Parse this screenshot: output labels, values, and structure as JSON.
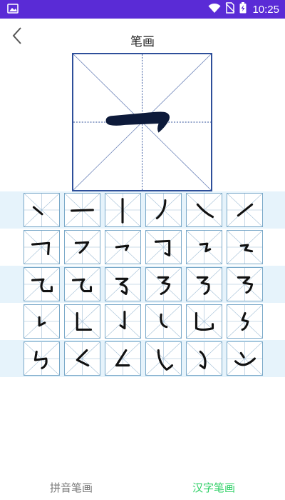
{
  "status_bar": {
    "time": "10:25",
    "bg_color": "#5a2bd6"
  },
  "header": {
    "title": "笔画",
    "back_icon": "chevron-left-icon"
  },
  "practice": {
    "character": "一",
    "border_color": "#2e4f9a"
  },
  "strokes": {
    "rows": 5,
    "columns": 6,
    "items": [
      "dian-stroke-icon",
      "heng-stroke-icon",
      "shu-stroke-icon",
      "pie-stroke-icon",
      "na-stroke-icon",
      "ti-stroke-icon",
      "hengzhe-stroke-icon",
      "henggou-stroke-icon",
      "hengpie-stroke-icon",
      "hengzhegou-stroke-icon",
      "hengzheti-stroke-icon",
      "hengzhewan-stroke-icon",
      "hengxiegou-stroke-icon",
      "hengzhewangou-stroke-icon",
      "hengpiewangou-stroke-icon",
      "hengzhezhepie-stroke-icon",
      "hengzhezhezhegou-stroke-icon",
      "hengzhezhezhe-stroke-icon",
      "shuti-stroke-icon",
      "shuzhe-stroke-icon",
      "shugou-stroke-icon",
      "shuwan-stroke-icon",
      "shuwangou-stroke-icon",
      "shuzhezhe-stroke-icon",
      "shuzhezhegou-stroke-icon",
      "piezhe-stroke-icon",
      "piedian-stroke-icon",
      "xiegou-stroke-icon",
      "wangou-stroke-icon",
      "wogou-stroke-icon"
    ],
    "band_color": "#e6f3fb",
    "cell_border_color": "#7aa9c9"
  },
  "tabs": [
    {
      "label": "拼音笔画",
      "active": false,
      "color": "#777777"
    },
    {
      "label": "汉字笔画",
      "active": true,
      "color": "#2fd066"
    }
  ]
}
